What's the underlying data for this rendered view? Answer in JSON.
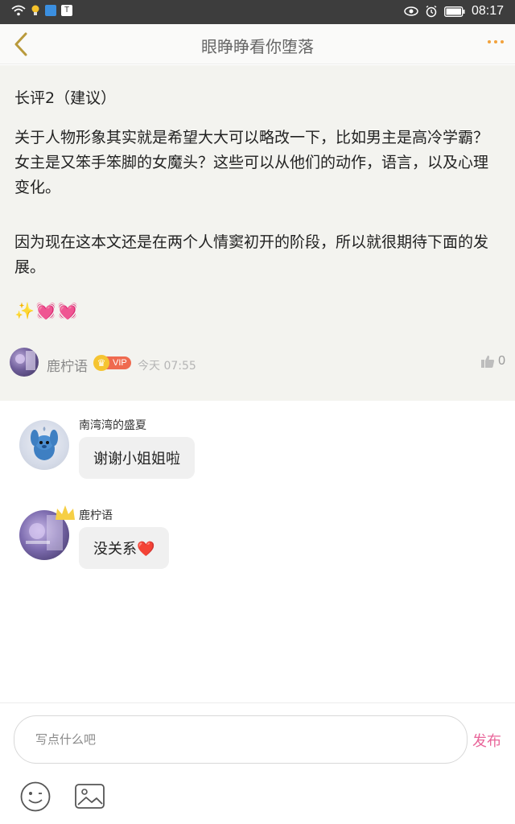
{
  "status_bar": {
    "time": "08:17",
    "icons": [
      "wifi-icon",
      "app-notification-icon",
      "app-notification-icon",
      "app-notification-icon",
      "eye-icon",
      "alarm-icon",
      "battery-icon"
    ]
  },
  "nav": {
    "title": "眼睁睁看你堕落",
    "back_icon": "chevron-left-icon",
    "more_icon": "more-dots-icon",
    "accent_color": "#c9a44a"
  },
  "post": {
    "heading": "长评2（建议）",
    "paragraphs": [
      "关于人物形象其实就是希望大大可以略改一下，比如男主是高冷学霸？女主是又笨手笨脚的女魔头？这些可以从他们的动作，语言，以及心理变化。",
      "因为现在这本文还是在两个人情窦初开的阶段，所以就很期待下面的发展。"
    ],
    "emojis": [
      "✨",
      "💓",
      "💓"
    ],
    "author": {
      "name": "鹿柠语",
      "badge": "VIP",
      "time": "今天 07:55"
    },
    "likes": "0"
  },
  "comments": [
    {
      "name": "南湾湾的盛夏",
      "text": "谢谢小姐姐啦"
    },
    {
      "name": "鹿柠语",
      "text": "没关系❤️"
    }
  ],
  "composer": {
    "placeholder": "写点什么吧",
    "send_label": "发布"
  }
}
